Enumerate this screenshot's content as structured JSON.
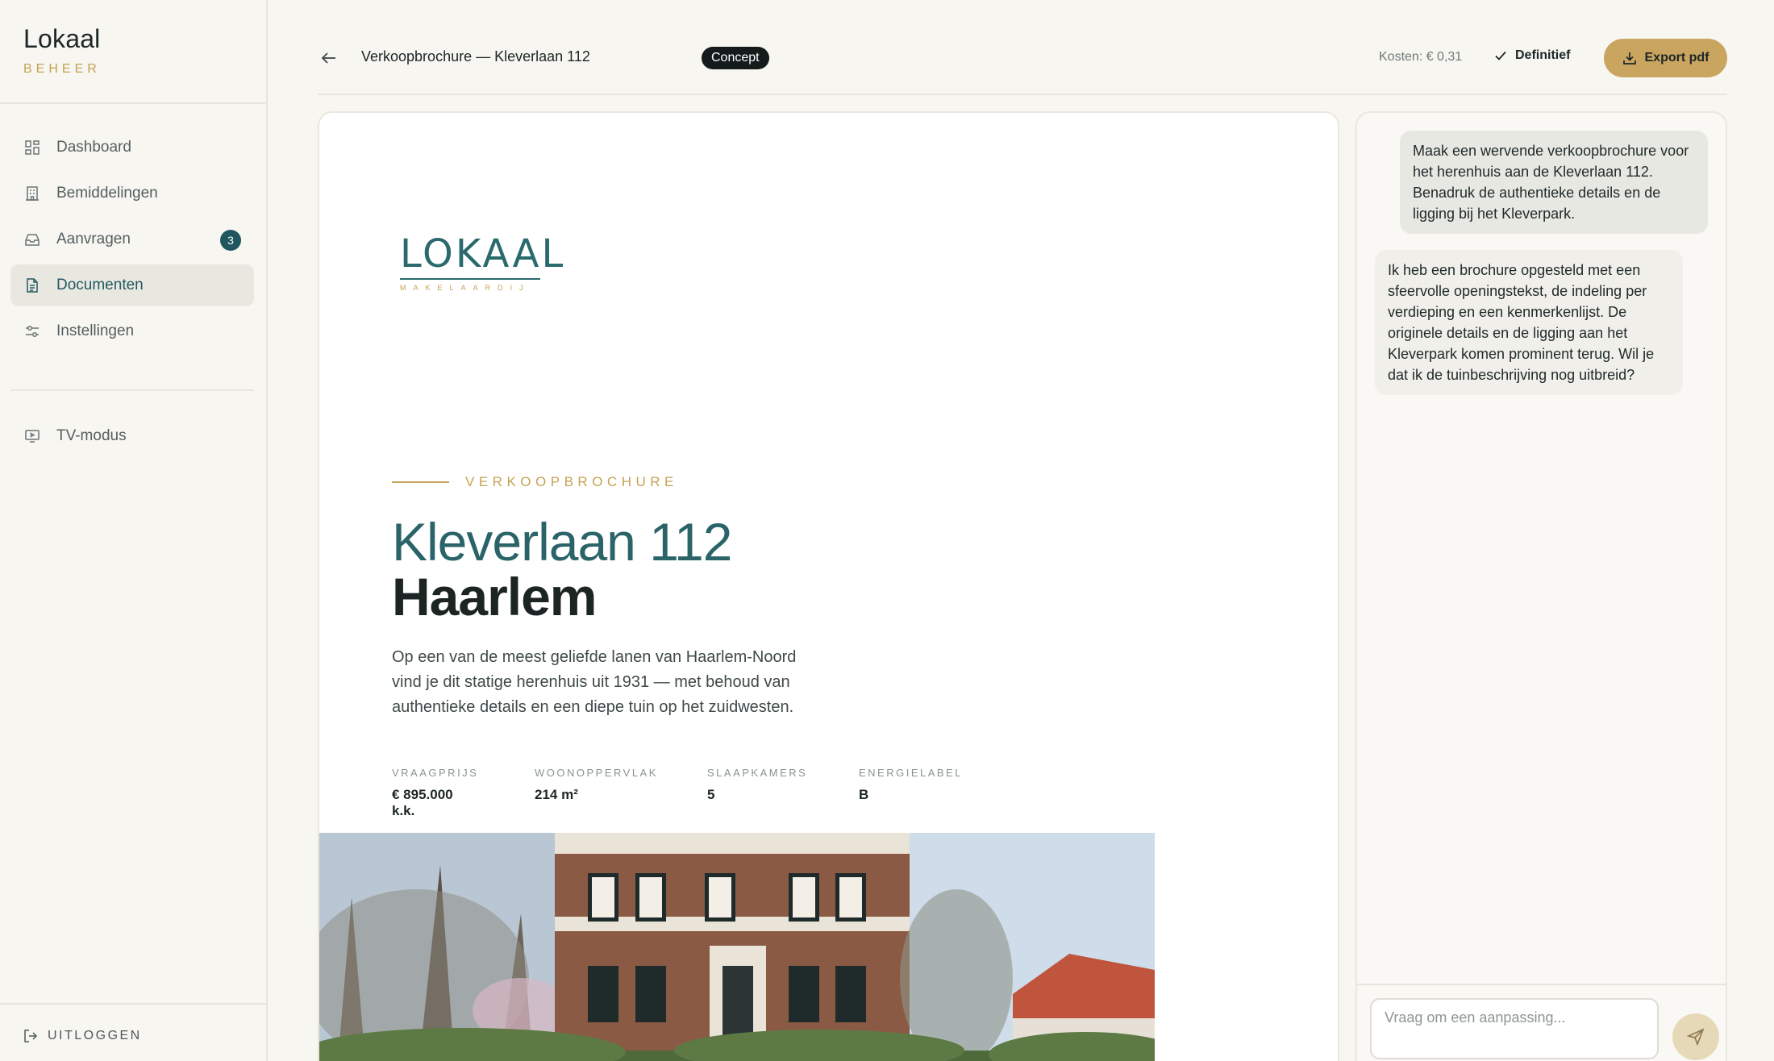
{
  "sidebar": {
    "brand_name": "Lokaal",
    "brand_sub": "BEHEER",
    "items": [
      {
        "label": "Dashboard",
        "icon": "grid-icon"
      },
      {
        "label": "Bemiddelingen",
        "icon": "building-icon"
      },
      {
        "label": "Aanvragen",
        "icon": "inbox-icon",
        "badge": "3"
      },
      {
        "label": "Documenten",
        "icon": "document-icon",
        "active": true
      },
      {
        "label": "Instellingen",
        "icon": "sliders-icon"
      }
    ],
    "tv_mode": {
      "label": "TV-modus",
      "icon": "monitor-icon"
    },
    "logout": {
      "label": "UITLOGGEN",
      "icon": "logout-icon"
    }
  },
  "header": {
    "title": "Verkoopbrochure — Kleverlaan 112",
    "status_badge": "Concept",
    "cost": "Kosten: € 0,31",
    "final_label": "Definitief",
    "export_label": "Export pdf"
  },
  "document": {
    "logo_word": "LOKAAL",
    "logo_sub": "MAKELAARDIJ",
    "eyebrow": "VERKOOPBROCHURE",
    "street": "Kleverlaan 112",
    "city": "Haarlem",
    "intro": "Op een van de meest geliefde lanen van Haarlem-Noord vind je dit statige herenhuis uit 1931 — met behoud van authentieke details en een diepe tuin op het zuidwesten.",
    "facts": [
      {
        "label": "VRAAGPRIJS",
        "value": "€ 895.000 k.k."
      },
      {
        "label": "WOONOPPERVLAK",
        "value": "214 m²"
      },
      {
        "label": "SLAAPKAMERS",
        "value": "5"
      },
      {
        "label": "ENERGIELABEL",
        "value": "B"
      }
    ]
  },
  "chat": {
    "user_message": "Maak een wervende verkoopbrochure voor het herenhuis aan de Kleverlaan 112. Benadruk de authentieke details en de ligging bij het Kleverpark.",
    "assistant_message": "Ik heb een brochure opgesteld met een sfeervolle openingstekst, de indeling per verdieping en een kenmerkenlijst. De originele details en de ligging aan het Kleverpark komen prominent terug. Wil je dat ik de tuinbeschrijving nog uitbreid?",
    "input_placeholder": "Vraag om een aanpassing..."
  },
  "colors": {
    "accent_gold": "#c9a55f",
    "brand_teal": "#2a6469",
    "active_nav_bg": "#e8e8e1",
    "badge_dark": "#141b1b"
  }
}
